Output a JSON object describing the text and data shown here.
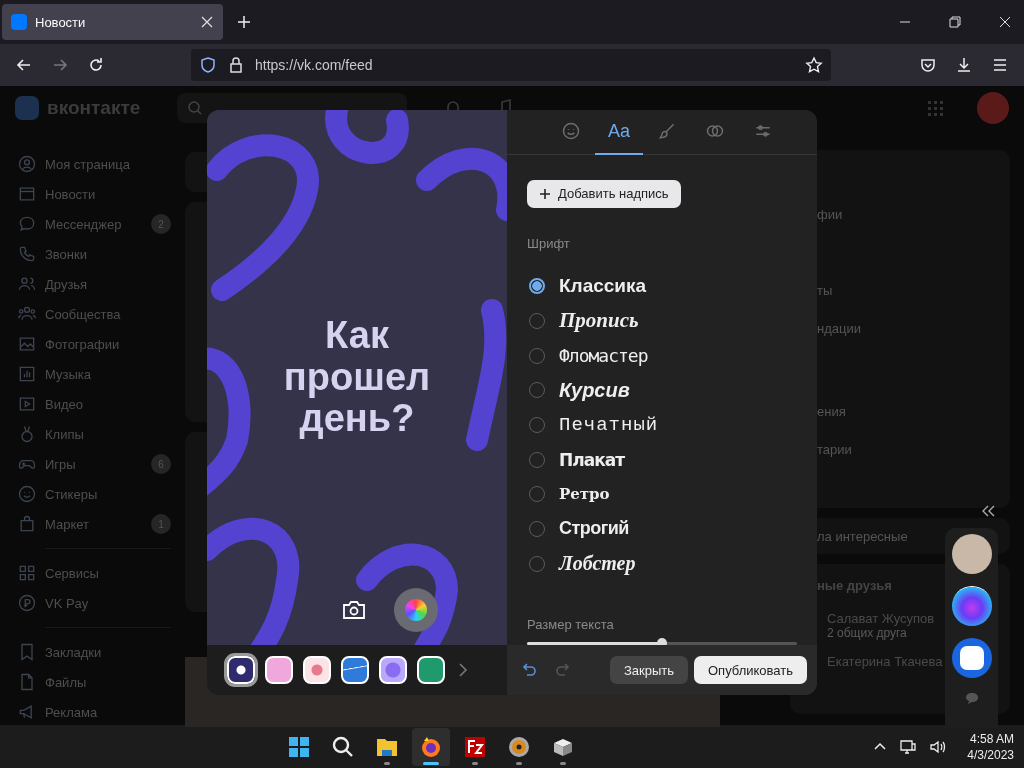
{
  "browser": {
    "tab": {
      "title": "Новости"
    },
    "url": "https://vk.com/feed"
  },
  "site": {
    "logo_text": "вконтакте",
    "sidebar": {
      "groups": [
        {
          "items": [
            {
              "label": "Моя страница",
              "kind": "profile"
            },
            {
              "label": "Новости",
              "kind": "news"
            },
            {
              "label": "Мессенджер",
              "kind": "messenger",
              "badge": "2"
            },
            {
              "label": "Звонки",
              "kind": "calls"
            },
            {
              "label": "Друзья",
              "kind": "friends"
            },
            {
              "label": "Сообщества",
              "kind": "communities"
            },
            {
              "label": "Фотографии",
              "kind": "photos"
            },
            {
              "label": "Музыка",
              "kind": "music"
            },
            {
              "label": "Видео",
              "kind": "video"
            },
            {
              "label": "Клипы",
              "kind": "clips"
            },
            {
              "label": "Игры",
              "kind": "games",
              "badge": "6"
            },
            {
              "label": "Стикеры",
              "kind": "stickers"
            },
            {
              "label": "Маркет",
              "kind": "market",
              "badge": "1"
            }
          ]
        },
        {
          "items": [
            {
              "label": "Сервисы",
              "kind": "services"
            },
            {
              "label": "VK Pay",
              "kind": "pay"
            }
          ]
        },
        {
          "items": [
            {
              "label": "Закладки",
              "kind": "bookmarks"
            },
            {
              "label": "Файлы",
              "kind": "files"
            },
            {
              "label": "Реклама",
              "kind": "ads"
            }
          ]
        }
      ]
    },
    "right_column": {
      "menu_fragments": [
        "фии",
        "ты",
        "ндации",
        "ения",
        "тарии"
      ],
      "interesting_fragment": "ла интересные",
      "friends_title": "ные друзья",
      "friends": [
        {
          "name": "Салават Жусупов",
          "note": "2 общих друга"
        },
        {
          "name": "Екатерина Ткачева"
        }
      ]
    }
  },
  "editor": {
    "canvas_text": "Как прошел день?",
    "tabs": [
      {
        "kind": "stickers",
        "selected": false
      },
      {
        "kind": "text",
        "label": "Aa",
        "selected": true
      },
      {
        "kind": "brush",
        "selected": false
      },
      {
        "kind": "filters",
        "selected": false
      },
      {
        "kind": "settings",
        "selected": false
      }
    ],
    "add_text_button": "Добавить надпись",
    "font_label": "Шрифт",
    "fonts": [
      {
        "label": "Классика",
        "kind": "classic",
        "selected": true
      },
      {
        "label": "Пропись",
        "kind": "script",
        "selected": false
      },
      {
        "label": "Фломастер",
        "kind": "marker",
        "selected": false
      },
      {
        "label": "Курсив",
        "kind": "italic",
        "selected": false
      },
      {
        "label": "Печатный",
        "kind": "typewriter",
        "selected": false
      },
      {
        "label": "Плакат",
        "kind": "poster",
        "selected": false
      },
      {
        "label": "Ретро",
        "kind": "retro",
        "selected": false
      },
      {
        "label": "Строгий",
        "kind": "strict",
        "selected": false
      },
      {
        "label": "Лобстер",
        "kind": "lobster",
        "selected": false
      }
    ],
    "size_label": "Размер текста",
    "size_slider": {
      "level": 0.5
    },
    "backgrounds": [
      {
        "kind": "dark",
        "selected": true
      },
      {
        "kind": "pink",
        "selected": false
      },
      {
        "kind": "heart",
        "selected": false
      },
      {
        "kind": "blue",
        "selected": false
      },
      {
        "kind": "star",
        "selected": false
      },
      {
        "kind": "green",
        "selected": false
      }
    ],
    "close_button": "Закрыть",
    "publish_button": "Опубликовать"
  },
  "taskbar": {
    "apps": [
      {
        "kind": "start",
        "running": false,
        "selected": false
      },
      {
        "kind": "search",
        "running": false,
        "selected": false
      },
      {
        "kind": "folder",
        "running": true,
        "selected": false
      },
      {
        "kind": "browser",
        "running": true,
        "selected": true
      },
      {
        "kind": "ftp",
        "running": true,
        "selected": false
      },
      {
        "kind": "disc",
        "running": true,
        "selected": false
      },
      {
        "kind": "tool",
        "running": true,
        "selected": false
      }
    ],
    "time": "4:58 AM",
    "date": "4/3/2023"
  }
}
